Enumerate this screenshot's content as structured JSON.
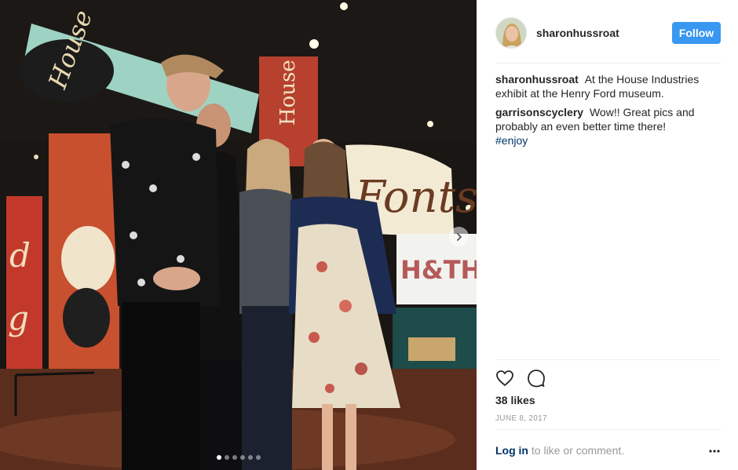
{
  "post": {
    "image_alt": "",
    "carousel": {
      "total": 6,
      "active_index": 0
    },
    "exhibit_signs": {
      "fonts": "Fonts",
      "house": "House",
      "banner": "H&TH"
    }
  },
  "header": {
    "username": "sharonhussroat",
    "follow_label": "Follow"
  },
  "comments": [
    {
      "user": "sharonhussroat",
      "text": "At the House Industries exhibit at the Henry Ford museum."
    },
    {
      "user": "garrisonscyclery",
      "text": "Wow!! Great pics and probably an even better time there!",
      "hashtag": "#enjoy"
    }
  ],
  "actions": {
    "like_icon": "heart-icon",
    "comment_icon": "comment-icon"
  },
  "likes": "38 likes",
  "date": "JUNE 8, 2017",
  "footer": {
    "login_label": "Log in",
    "login_rest": "to like or comment."
  },
  "colors": {
    "accent": "#3897f0",
    "link": "#003569",
    "muted": "#999999"
  }
}
